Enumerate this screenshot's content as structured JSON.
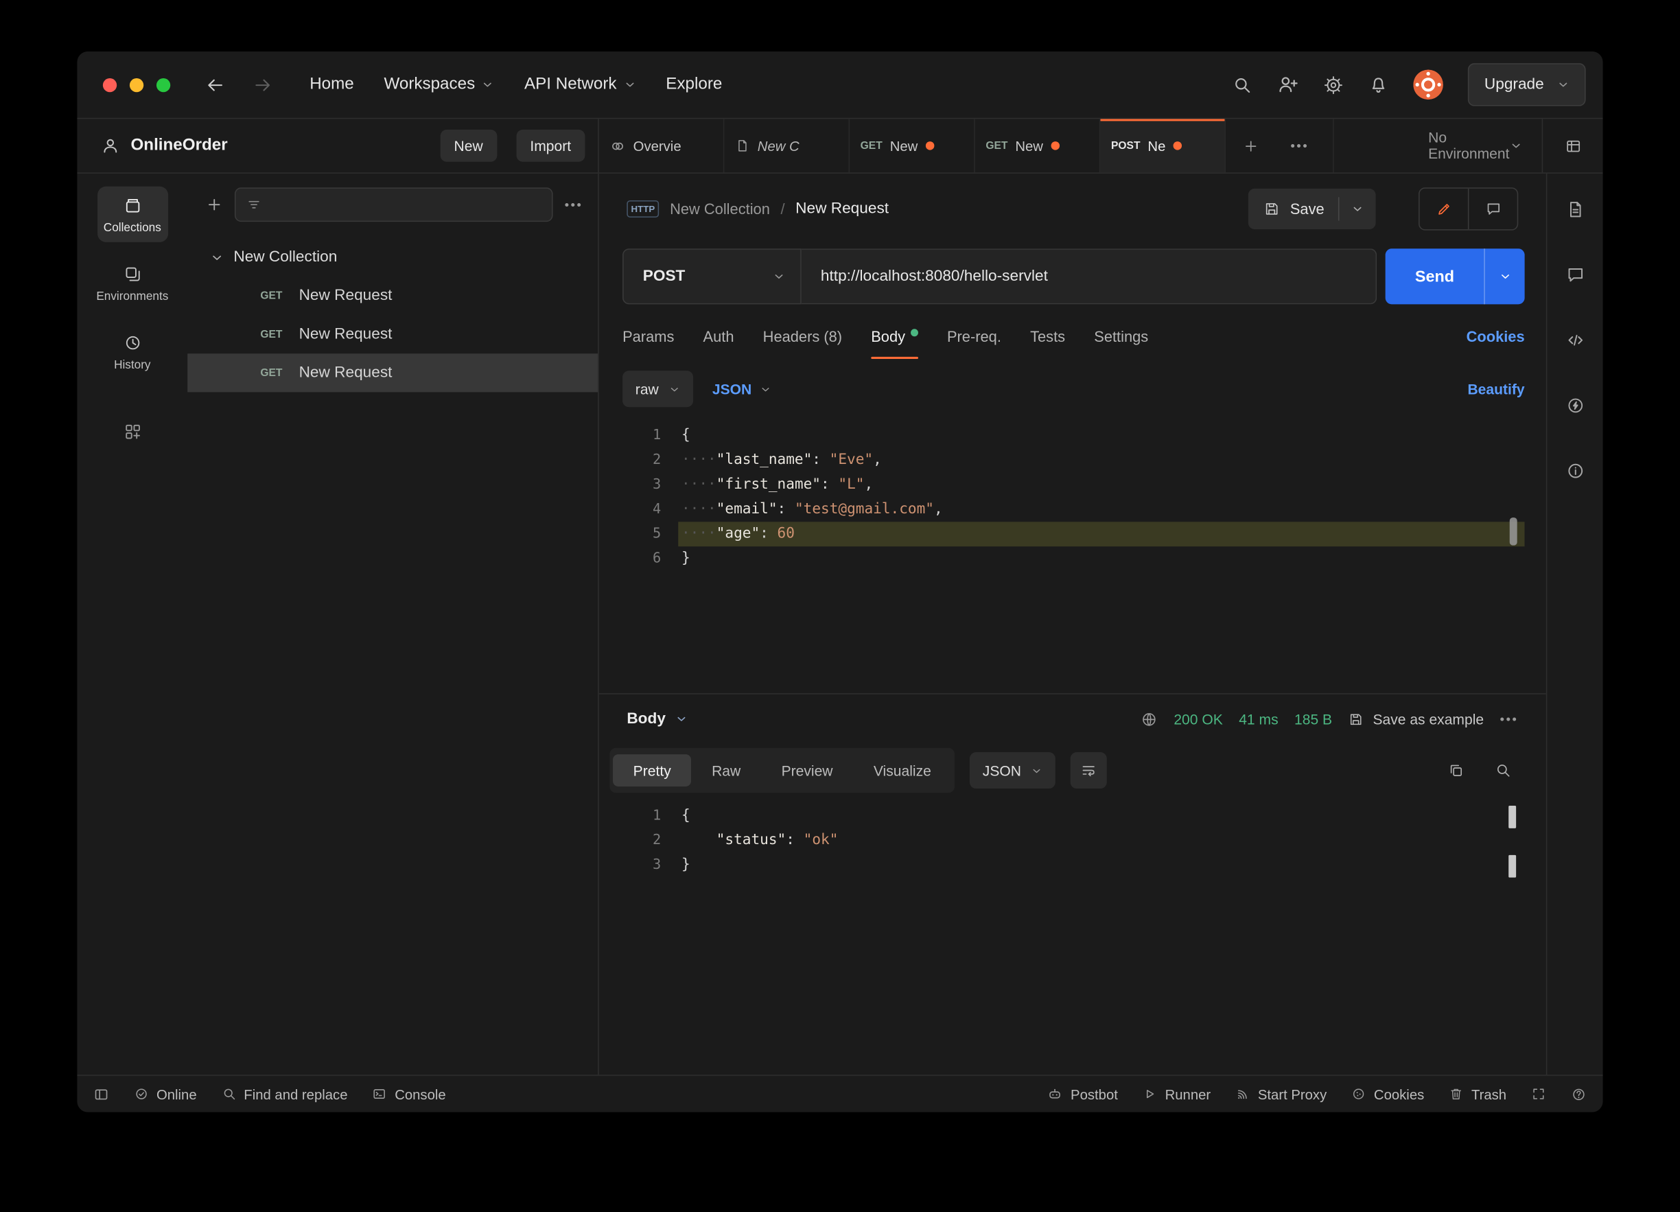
{
  "colors": {
    "accent": "#ff6c37",
    "link": "#5c9dff",
    "success": "#4cb782",
    "send": "#2a6bed"
  },
  "ui": {
    "more": "•••",
    "http_badge": "HTTP"
  },
  "chrome": {
    "menu": [
      "Home",
      "Workspaces",
      "API Network",
      "Explore"
    ],
    "upgrade_label": "Upgrade"
  },
  "workspace": {
    "name": "OnlineOrder",
    "new_label": "New",
    "import_label": "Import"
  },
  "rail": {
    "collections_label": "Collections",
    "environments_label": "Environments",
    "history_label": "History"
  },
  "sidebar": {
    "collection_name": "New Collection",
    "requests": [
      {
        "method": "GET",
        "name": "New Request"
      },
      {
        "method": "GET",
        "name": "New Request"
      },
      {
        "method": "GET",
        "name": "New Request"
      }
    ]
  },
  "tabs": {
    "overview_label": "Overvie",
    "doc_label": "New C",
    "request_tabs": [
      {
        "method": "GET",
        "label": "New"
      },
      {
        "method": "GET",
        "label": "New"
      },
      {
        "method": "POST",
        "label": "Ne"
      }
    ],
    "environment": "No Environment"
  },
  "request": {
    "breadcrumb_collection": "New Collection",
    "breadcrumb_sep": "/",
    "breadcrumb_name": "New Request",
    "save_label": "Save",
    "method": "POST",
    "url": "http://localhost:8080/hello-servlet",
    "send_label": "Send",
    "tabs": [
      "Params",
      "Auth",
      "Headers (8)",
      "Body",
      "Pre-req.",
      "Tests",
      "Settings"
    ],
    "cookies_label": "Cookies",
    "body_type": "raw",
    "body_lang": "JSON",
    "beautify_label": "Beautify"
  },
  "request_editor": {
    "lines": [
      {
        "n": "1",
        "tokens": [
          [
            "p",
            "{"
          ]
        ]
      },
      {
        "n": "2",
        "tokens": [
          [
            "d",
            "····"
          ],
          [
            "k",
            "\"last_name\""
          ],
          [
            "p",
            ": "
          ],
          [
            "s",
            "\"Eve\""
          ],
          [
            "p",
            ","
          ]
        ]
      },
      {
        "n": "3",
        "tokens": [
          [
            "d",
            "····"
          ],
          [
            "k",
            "\"first_name\""
          ],
          [
            "p",
            ": "
          ],
          [
            "s",
            "\"L\""
          ],
          [
            "p",
            ","
          ]
        ]
      },
      {
        "n": "4",
        "tokens": [
          [
            "d",
            "····"
          ],
          [
            "k",
            "\"email\""
          ],
          [
            "p",
            ": "
          ],
          [
            "s",
            "\"test@gmail.com\""
          ],
          [
            "p",
            ","
          ]
        ]
      },
      {
        "n": "5",
        "hl": true,
        "tokens": [
          [
            "d",
            "····"
          ],
          [
            "k",
            "\"age\""
          ],
          [
            "p",
            ": "
          ],
          [
            "num",
            "60"
          ]
        ]
      },
      {
        "n": "6",
        "tokens": [
          [
            "p",
            "}"
          ]
        ]
      }
    ]
  },
  "response": {
    "body_label": "Body",
    "status": "200 OK",
    "time": "41 ms",
    "size": "185 B",
    "save_example_label": "Save as example",
    "views": [
      "Pretty",
      "Raw",
      "Preview",
      "Visualize"
    ],
    "lang": "JSON"
  },
  "response_editor": {
    "lines": [
      {
        "n": "1",
        "tokens": [
          [
            "p",
            "{"
          ]
        ]
      },
      {
        "n": "2",
        "tokens": [
          [
            "w",
            "    "
          ],
          [
            "k",
            "\"status\""
          ],
          [
            "p",
            ": "
          ],
          [
            "s",
            "\"ok\""
          ]
        ]
      },
      {
        "n": "3",
        "tokens": [
          [
            "p",
            "}"
          ]
        ]
      }
    ]
  },
  "footer": {
    "online_label": "Online",
    "find_label": "Find and replace",
    "console_label": "Console",
    "postbot_label": "Postbot",
    "runner_label": "Runner",
    "proxy_label": "Start Proxy",
    "cookies_label": "Cookies",
    "trash_label": "Trash"
  }
}
